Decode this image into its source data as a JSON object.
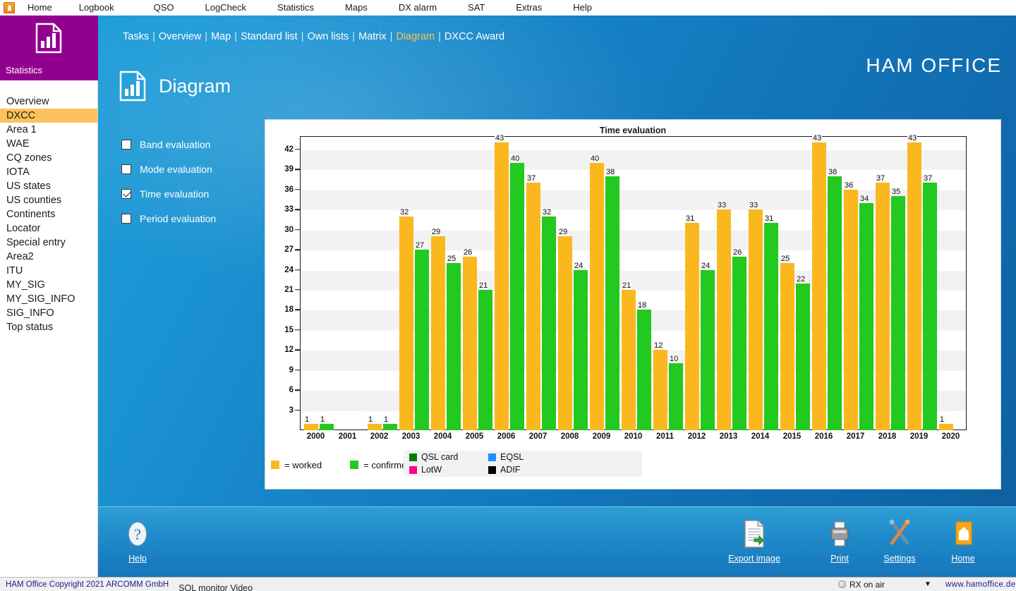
{
  "menubar": {
    "app_icon": "home-tile-icon",
    "items": [
      {
        "label": "Home"
      },
      {
        "label": "Logbook"
      },
      {
        "label": "QSO"
      },
      {
        "label": "LogCheck"
      },
      {
        "label": "Statistics"
      },
      {
        "label": "Maps"
      },
      {
        "label": "DX alarm"
      },
      {
        "label": "SAT"
      },
      {
        "label": "Extras"
      },
      {
        "label": "Help"
      }
    ]
  },
  "tile": {
    "label": "Statistics",
    "icon": "bar-chart-document-icon",
    "color": "#92008f"
  },
  "sidebar": {
    "items": [
      {
        "label": "Overview",
        "active": false
      },
      {
        "label": "DXCC",
        "active": true
      },
      {
        "label": "Area 1",
        "active": false
      },
      {
        "label": "WAE",
        "active": false
      },
      {
        "label": "CQ zones",
        "active": false
      },
      {
        "label": "IOTA",
        "active": false
      },
      {
        "label": "US states",
        "active": false
      },
      {
        "label": "US counties",
        "active": false
      },
      {
        "label": "Continents",
        "active": false
      },
      {
        "label": "Locator",
        "active": false
      },
      {
        "label": "Special entry",
        "active": false
      },
      {
        "label": "Area2",
        "active": false
      },
      {
        "label": "ITU",
        "active": false
      },
      {
        "label": "MY_SIG",
        "active": false
      },
      {
        "label": "MY_SIG_INFO",
        "active": false
      },
      {
        "label": "SIG_INFO",
        "active": false
      },
      {
        "label": "Top status",
        "active": false
      }
    ],
    "active_color": "#fcc25d"
  },
  "header": {
    "brand": "HAM OFFICE",
    "page_title": "Diagram",
    "page_icon": "bar-chart-document-icon",
    "tabs": [
      {
        "label": "Tasks",
        "active": false
      },
      {
        "label": "Overview",
        "active": false
      },
      {
        "label": "Map",
        "active": false
      },
      {
        "label": "Standard list",
        "active": false
      },
      {
        "label": "Own lists",
        "active": false
      },
      {
        "label": "Matrix",
        "active": false
      },
      {
        "label": "Diagram",
        "active": true
      },
      {
        "label": "DXCC Award",
        "active": false
      }
    ],
    "active_tab_color": "#ffc24d"
  },
  "options": [
    {
      "label": "Band evaluation",
      "checked": false
    },
    {
      "label": "Mode evaluation",
      "checked": false
    },
    {
      "label": "Time evaluation",
      "checked": true
    },
    {
      "label": "Period evaluation",
      "checked": false
    }
  ],
  "chart_data": {
    "type": "bar",
    "title": "Time evaluation",
    "xlabel": "",
    "ylabel": "",
    "ylim": [
      0,
      44
    ],
    "yticks": [
      3,
      6,
      9,
      12,
      15,
      18,
      21,
      24,
      27,
      30,
      33,
      36,
      39,
      42
    ],
    "grid": true,
    "legend_position": "bottom-left",
    "categories": [
      "2000",
      "2001",
      "2002",
      "2003",
      "2004",
      "2005",
      "2006",
      "2007",
      "2008",
      "2009",
      "2010",
      "2011",
      "2012",
      "2013",
      "2014",
      "2015",
      "2016",
      "2017",
      "2018",
      "2019",
      "2020"
    ],
    "series": [
      {
        "name": "= worked",
        "color": "#fbb81e",
        "values": [
          1,
          0,
          1,
          32,
          29,
          26,
          43,
          37,
          29,
          40,
          21,
          12,
          31,
          33,
          33,
          25,
          43,
          36,
          37,
          43,
          1
        ]
      },
      {
        "name": "= confirmed",
        "color": "#22c91e",
        "values": [
          1,
          0,
          1,
          27,
          25,
          21,
          40,
          32,
          24,
          38,
          18,
          10,
          24,
          26,
          31,
          22,
          38,
          34,
          35,
          37,
          0
        ]
      }
    ]
  },
  "legend": {
    "primary": [
      {
        "label": "= worked",
        "color": "#fbb81e"
      },
      {
        "label": "= confirmed",
        "color": "#22c91e"
      }
    ],
    "confirmation_types": [
      {
        "label": "QSL card",
        "color": "#008000"
      },
      {
        "label": "EQSL",
        "color": "#1e90ff"
      },
      {
        "label": "LotW",
        "color": "#ff0090"
      },
      {
        "label": "ADIF",
        "color": "#000000"
      }
    ]
  },
  "toolbar": {
    "items": [
      {
        "label": "Help",
        "icon": "question-circle-icon",
        "accel": "H"
      },
      {
        "label": "Export image",
        "icon": "document-export-icon",
        "accel": "E"
      },
      {
        "label": "Print",
        "icon": "printer-icon",
        "accel": "P"
      },
      {
        "label": "Settings",
        "icon": "tools-wrench-screwdriver-icon",
        "accel": "S"
      },
      {
        "label": "Home",
        "icon": "home-icon",
        "accel": "H"
      }
    ]
  },
  "statusbar": {
    "copyright": "HAM Office Copyright 2021 ARCOMM GmbH",
    "sol_monitor": "SOL monitor  Video",
    "rx_status": "RX on air",
    "url": "www.hamoffice.de",
    "caret": "▼"
  }
}
